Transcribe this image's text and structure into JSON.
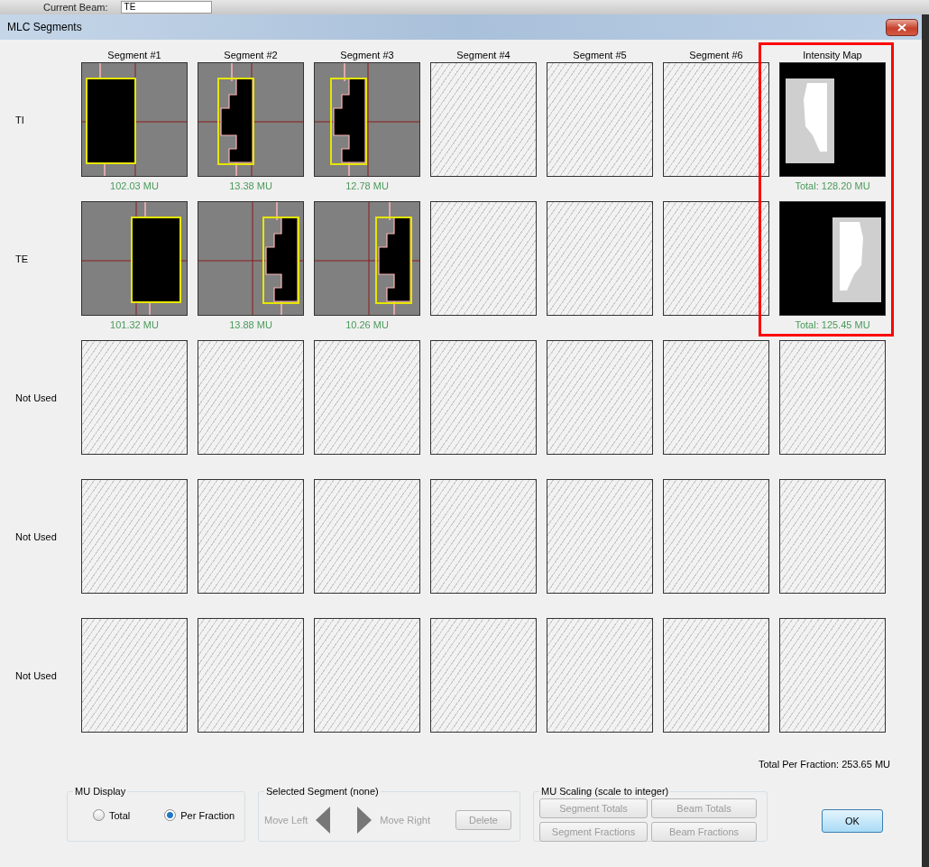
{
  "background_app": {
    "label": "Current Beam:",
    "value": "TE"
  },
  "window": {
    "title": "MLC Segments"
  },
  "columns": [
    "Segment #1",
    "Segment #2",
    "Segment #3",
    "Segment #4",
    "Segment #5",
    "Segment #6",
    "Intensity Map"
  ],
  "rows": [
    {
      "label": "TI",
      "cells": [
        {
          "kind": "segment",
          "mu": "102.03 MU"
        },
        {
          "kind": "segment",
          "mu": "13.38 MU"
        },
        {
          "kind": "segment",
          "mu": "12.78 MU"
        },
        {
          "kind": "empty"
        },
        {
          "kind": "empty"
        },
        {
          "kind": "empty"
        },
        {
          "kind": "intensity",
          "mu": "Total: 128.20 MU"
        }
      ]
    },
    {
      "label": "TE",
      "cells": [
        {
          "kind": "segment",
          "mu": "101.32 MU"
        },
        {
          "kind": "segment",
          "mu": "13.88 MU"
        },
        {
          "kind": "segment",
          "mu": "10.26 MU"
        },
        {
          "kind": "empty"
        },
        {
          "kind": "empty"
        },
        {
          "kind": "empty"
        },
        {
          "kind": "intensity",
          "mu": "Total: 125.45 MU"
        }
      ]
    },
    {
      "label": "Not Used",
      "cells": [
        {
          "kind": "empty"
        },
        {
          "kind": "empty"
        },
        {
          "kind": "empty"
        },
        {
          "kind": "empty"
        },
        {
          "kind": "empty"
        },
        {
          "kind": "empty"
        },
        {
          "kind": "empty"
        }
      ]
    },
    {
      "label": "Not Used",
      "cells": [
        {
          "kind": "empty"
        },
        {
          "kind": "empty"
        },
        {
          "kind": "empty"
        },
        {
          "kind": "empty"
        },
        {
          "kind": "empty"
        },
        {
          "kind": "empty"
        },
        {
          "kind": "empty"
        }
      ]
    },
    {
      "label": "Not Used",
      "cells": [
        {
          "kind": "empty"
        },
        {
          "kind": "empty"
        },
        {
          "kind": "empty"
        },
        {
          "kind": "empty"
        },
        {
          "kind": "empty"
        },
        {
          "kind": "empty"
        },
        {
          "kind": "empty"
        }
      ]
    }
  ],
  "intensity_highlight": true,
  "total_per_fraction": "Total Per Fraction: 253.65 MU",
  "mu_display": {
    "title": "MU Display",
    "options": [
      {
        "label": "Total",
        "selected": false
      },
      {
        "label": "Per Fraction",
        "selected": true
      }
    ]
  },
  "selected_segment": {
    "title": "Selected Segment (none)",
    "move_left": {
      "label": "Move Left",
      "disabled": true
    },
    "move_right": {
      "label": "Move Right",
      "disabled": true
    },
    "delete": {
      "label": "Delete",
      "disabled": true
    }
  },
  "mu_scaling": {
    "title": "MU Scaling (scale to integer)",
    "buttons": [
      {
        "label": "Segment Totals",
        "disabled": true
      },
      {
        "label": "Beam Totals",
        "disabled": true
      },
      {
        "label": "Segment Fractions",
        "disabled": true
      },
      {
        "label": "Beam Fractions",
        "disabled": true
      }
    ]
  },
  "ok": "OK"
}
